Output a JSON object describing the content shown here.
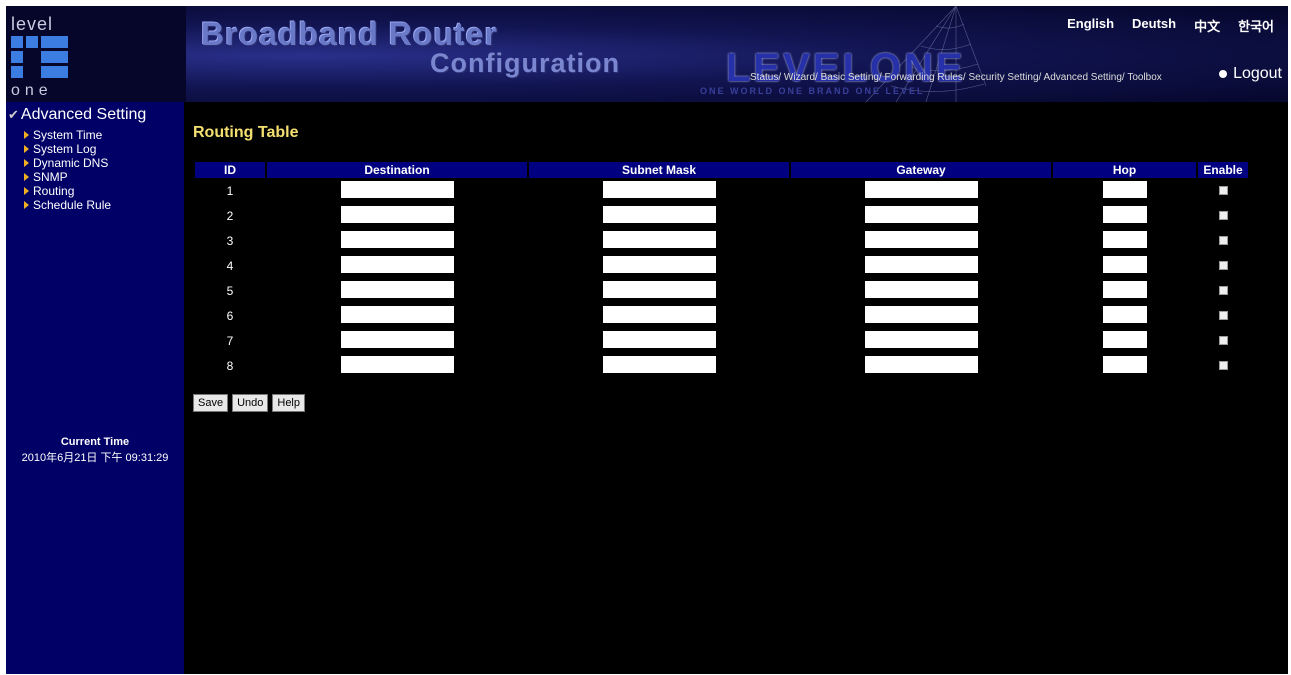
{
  "header": {
    "logo_top": "level",
    "logo_bottom": "one",
    "title_line1": "Broadband Router",
    "title_line2": "Configuration",
    "brand": "LEVELONE",
    "tagline": "ONE WORLD  ONE BRAND  ONE LEVEL",
    "languages": [
      "English",
      "Deutsh",
      "中文",
      "한국어"
    ],
    "nav": [
      "Status/",
      "Wizard/",
      "Basic Setting/",
      "Forwarding Rules/",
      "Security Setting/",
      "Advanced Setting/",
      "Toolbox"
    ],
    "logout": "Logout"
  },
  "sidebar": {
    "section": "Advanced Setting",
    "items": [
      "System Time",
      "System Log",
      "Dynamic DNS",
      "SNMP",
      "Routing",
      "Schedule Rule"
    ],
    "clock_title": "Current Time",
    "clock_value": "2010年6月21日 下午 09:31:29"
  },
  "main": {
    "title": "Routing Table",
    "columns": [
      "ID",
      "Destination",
      "Subnet Mask",
      "Gateway",
      "Hop",
      "Enable"
    ],
    "rows": [
      "1",
      "2",
      "3",
      "4",
      "5",
      "6",
      "7",
      "8"
    ],
    "buttons": {
      "save": "Save",
      "undo": "Undo",
      "help": "Help"
    }
  },
  "colors": {
    "sidebar_bg": "#000066",
    "header_cell_bg": "#000080",
    "title_color": "#f4e070",
    "menu_arrow": "#f0b020"
  }
}
